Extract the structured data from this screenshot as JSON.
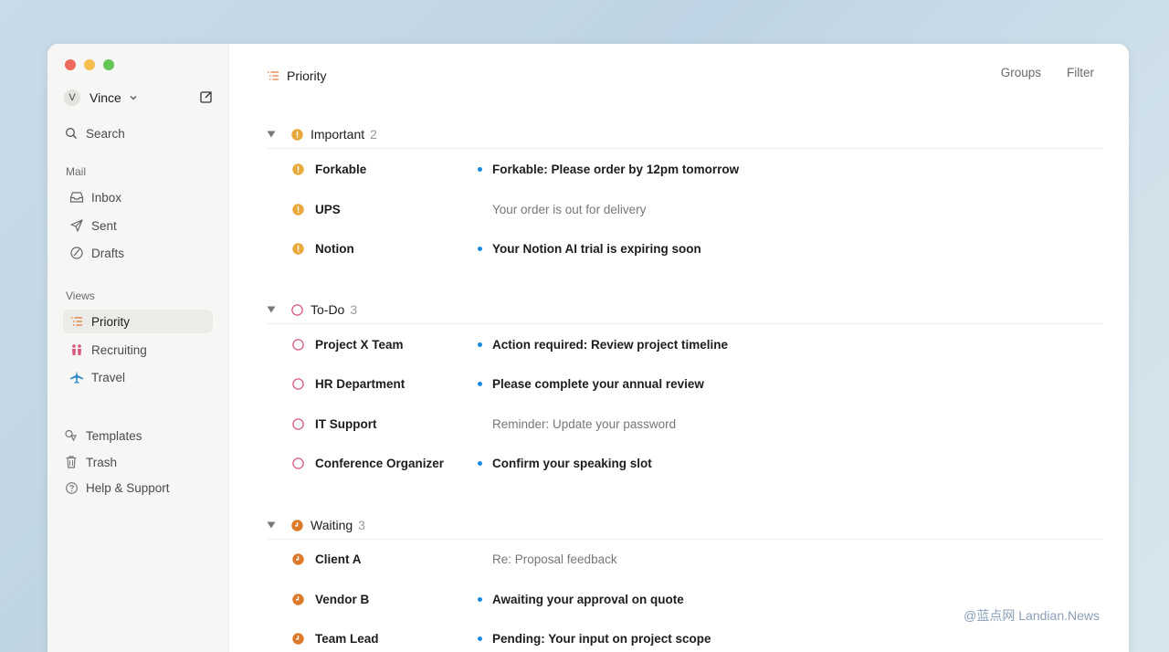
{
  "sidebar": {
    "account": {
      "initial": "V",
      "name": "Vince"
    },
    "search_label": "Search",
    "mail_section": "Mail",
    "mail_items": [
      {
        "label": "Inbox",
        "icon": "inbox-icon"
      },
      {
        "label": "Sent",
        "icon": "send-icon"
      },
      {
        "label": "Drafts",
        "icon": "draft-icon"
      }
    ],
    "views_section": "Views",
    "view_items": [
      {
        "label": "Priority",
        "icon": "priority-list-icon",
        "active": true
      },
      {
        "label": "Recruiting",
        "icon": "people-icon"
      },
      {
        "label": "Travel",
        "icon": "plane-icon"
      }
    ],
    "footer_items": [
      {
        "label": "Templates",
        "icon": "templates-icon"
      },
      {
        "label": "Trash",
        "icon": "trash-icon"
      },
      {
        "label": "Help & Support",
        "icon": "help-icon"
      }
    ]
  },
  "header": {
    "title": "Priority",
    "groups_label": "Groups",
    "filter_label": "Filter"
  },
  "groups": [
    {
      "name": "Important",
      "count": "2",
      "icon": "important-icon",
      "color": "#e8a93a",
      "rows": [
        {
          "sender": "Forkable",
          "subject": "Forkable: Please order by 12pm tomorrow",
          "unread": true
        },
        {
          "sender": "UPS",
          "subject": "Your order is out for delivery",
          "unread": false
        },
        {
          "sender": "Notion",
          "subject": "Your Notion AI trial is expiring soon",
          "unread": true
        }
      ]
    },
    {
      "name": "To-Do",
      "count": "3",
      "icon": "todo-circle-icon",
      "color": "#d8587f",
      "rows": [
        {
          "sender": "Project X Team",
          "subject": "Action required: Review project timeline",
          "unread": true
        },
        {
          "sender": "HR Department",
          "subject": "Please complete your annual review",
          "unread": true
        },
        {
          "sender": "IT Support",
          "subject": "Reminder: Update your password",
          "unread": false
        },
        {
          "sender": "Conference Organizer",
          "subject": "Confirm your speaking slot",
          "unread": true
        }
      ]
    },
    {
      "name": "Waiting",
      "count": "3",
      "icon": "clock-icon",
      "color": "#dc7a2c",
      "rows": [
        {
          "sender": "Client A",
          "subject": "Re: Proposal feedback",
          "unread": false
        },
        {
          "sender": "Vendor B",
          "subject": "Awaiting your approval on quote",
          "unread": true
        },
        {
          "sender": "Team Lead",
          "subject": "Pending: Your input on project scope",
          "unread": true
        }
      ]
    }
  ],
  "watermark": "@蓝点网 Landian.News"
}
